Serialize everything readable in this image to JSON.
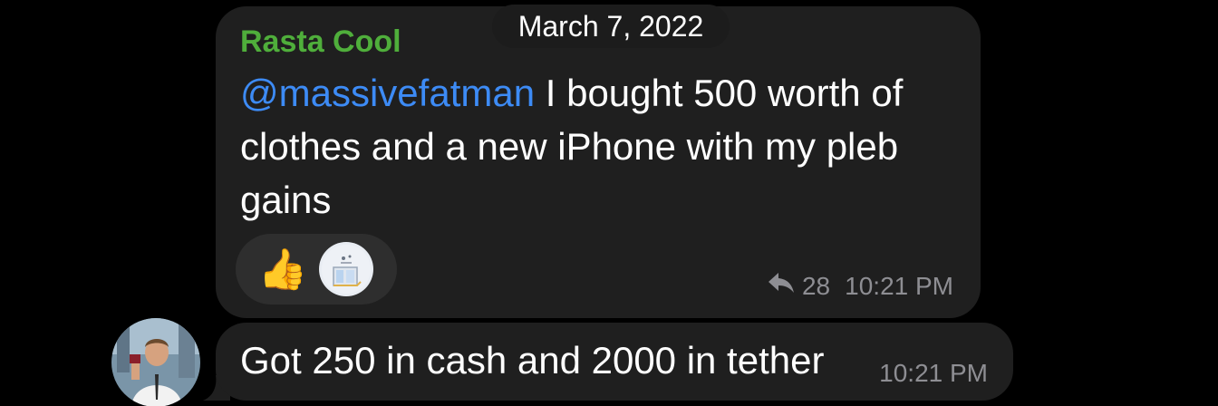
{
  "date_pill": "March 7, 2022",
  "message1": {
    "sender": "Rasta Cool",
    "mention": "@massivefatman",
    "text": " I bought 500 worth of clothes and a new iPhone with my pleb gains",
    "reactions": [
      {
        "icon": "thumbs-up-icon",
        "glyph": "👍"
      },
      {
        "icon": "sticker-reaction-icon"
      }
    ],
    "reply_icon": "reply-arrow-icon",
    "reply_count": "28",
    "time": "10:21 PM"
  },
  "message2": {
    "text": "Got 250 in cash and 2000 in tether",
    "time": "10:21 PM"
  },
  "colors": {
    "background": "#000000",
    "bubble": "#1f1f1f",
    "sender_name": "#4fae3b",
    "mention": "#3d8bf5",
    "meta": "#8e8e93"
  }
}
